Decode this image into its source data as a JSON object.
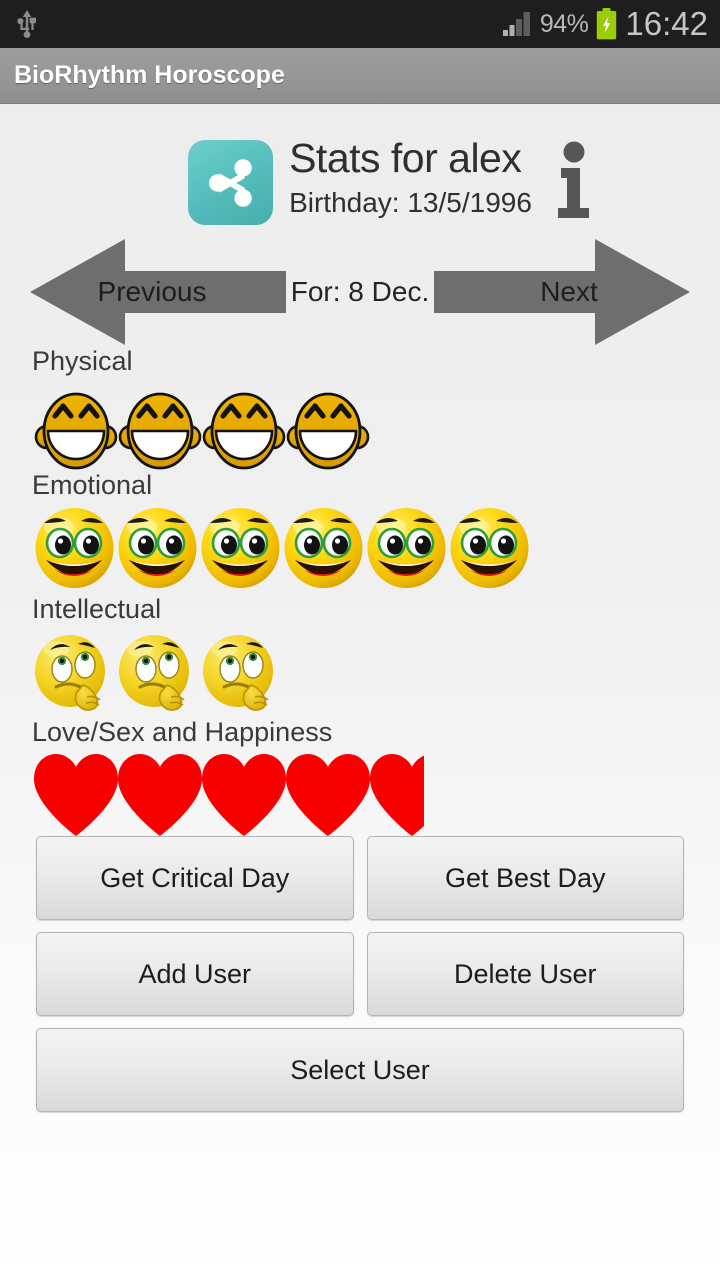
{
  "status_bar": {
    "usb_icon": "usb-icon",
    "signal_icon": "signal-bars-icon",
    "signal_bars_filled": 2,
    "signal_bars_total": 4,
    "battery_percent": "94%",
    "battery_icon": "battery-charging-icon",
    "clock": "16:42"
  },
  "title_bar": {
    "app_title": "BioRhythm Horoscope"
  },
  "header": {
    "share_icon": "share-icon",
    "stats_title": "Stats for alex",
    "birthday": "Birthday: 13/5/1996",
    "info_icon": "info-icon"
  },
  "nav": {
    "previous_label": "Previous",
    "next_label": "Next",
    "previous_icon": "arrow-left-icon",
    "next_icon": "arrow-right-icon",
    "for_date": "For: 8 Dec."
  },
  "metrics": [
    {
      "label": "Physical",
      "icon": "laughing-face-icon",
      "count": 4,
      "clipped_last": false
    },
    {
      "label": "Emotional",
      "icon": "smiling-face-icon",
      "count": 6,
      "clipped_last": false
    },
    {
      "label": "Intellectual",
      "icon": "thinking-face-icon",
      "count": 3,
      "clipped_last": false
    },
    {
      "label": "Love/Sex and Happiness",
      "icon": "heart-icon",
      "count": 5,
      "clipped_last": true
    }
  ],
  "buttons": {
    "get_critical_day": "Get Critical Day",
    "get_best_day": "Get Best Day",
    "add_user": "Add User",
    "delete_user": "Delete User",
    "select_user": "Select User"
  },
  "colors": {
    "status_bar_bg": "#1e1e1e",
    "title_bar_bg": "#969696",
    "page_bg": "#efefef",
    "share_icon_teal": "#53bcba",
    "arrow_gray": "#6e6e6e",
    "heart_red": "#f90000",
    "face_yellow": "#f2c40c",
    "battery_green": "#99cc00",
    "button_face": "#e8e8e8"
  }
}
